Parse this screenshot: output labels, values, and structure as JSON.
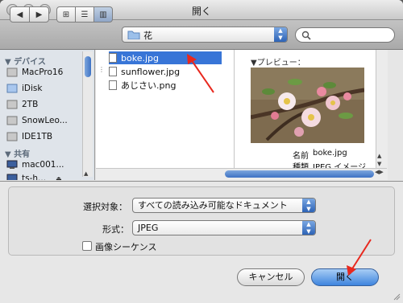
{
  "window": {
    "title": "開く"
  },
  "toolbar": {
    "path_popup": {
      "folder_name": "花"
    },
    "search": {
      "placeholder": ""
    }
  },
  "sidebar": {
    "sections": [
      {
        "header": "▼ デバイス",
        "items": [
          "MacPro16",
          "iDisk",
          "2TB",
          "SnowLeo...",
          "IDE1TB"
        ]
      },
      {
        "header": "▼ 共有",
        "items": [
          "mac001...",
          "ts-h..."
        ]
      }
    ]
  },
  "files": [
    {
      "name": "boke.jpg",
      "selected": true
    },
    {
      "name": "sunflower.jpg",
      "selected": false
    },
    {
      "name": "あじさい.png",
      "selected": false
    }
  ],
  "preview": {
    "label": "▼プレビュー：",
    "meta": [
      {
        "key": "名前",
        "value": "boke.jpg"
      },
      {
        "key": "種類",
        "value": "JPEG イメージ"
      }
    ]
  },
  "options": {
    "enable_label": "選択対象：",
    "enable_value": "すべての読み込み可能なドキュメント",
    "format_label": "形式：",
    "format_value": "JPEG",
    "image_sequence_label": "画像シーケンス",
    "image_sequence_checked": false
  },
  "buttons": {
    "cancel": "キャンセル",
    "open": "開く"
  },
  "colors": {
    "selection": "#3875d7",
    "annotation_arrow": "#e8281e"
  }
}
